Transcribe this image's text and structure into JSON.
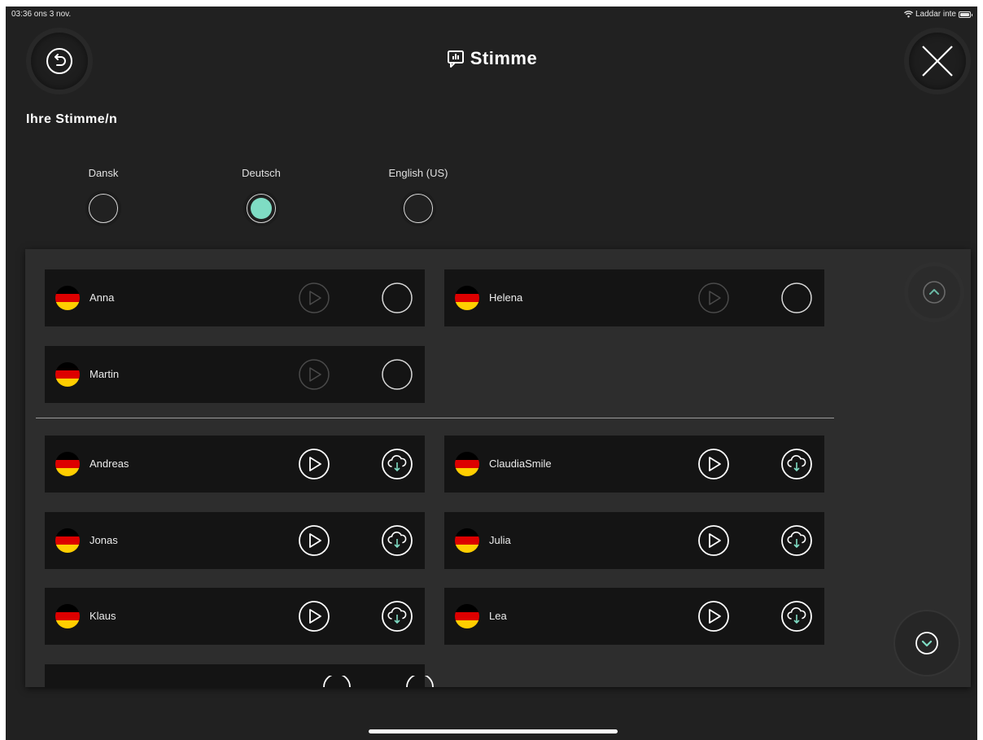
{
  "status": {
    "time_date": "03:36  ons 3 nov.",
    "battery_text": "Laddar inte"
  },
  "header": {
    "title": "Stimme",
    "back_icon": "back-icon",
    "close_icon": "close-icon"
  },
  "section_title": "Ihre Stimme/n",
  "languages": [
    {
      "label": "Dansk",
      "selected": false
    },
    {
      "label": "Deutsch",
      "selected": true
    },
    {
      "label": "English (US)",
      "selected": false
    }
  ],
  "installed_voices": [
    {
      "name": "Anna",
      "action": "radio"
    },
    {
      "name": "Helena",
      "action": "radio"
    },
    {
      "name": "Martin",
      "action": "radio"
    }
  ],
  "available_voices": [
    {
      "name": "Andreas",
      "action": "download"
    },
    {
      "name": "ClaudiaSmile",
      "action": "download"
    },
    {
      "name": "Jonas",
      "action": "download"
    },
    {
      "name": "Julia",
      "action": "download"
    },
    {
      "name": "Klaus",
      "action": "download"
    },
    {
      "name": "Lea",
      "action": "download"
    }
  ],
  "colors": {
    "accent": "#7fdcc4",
    "background": "#212121",
    "panel": "#2d2d2d",
    "card": "#141414"
  }
}
